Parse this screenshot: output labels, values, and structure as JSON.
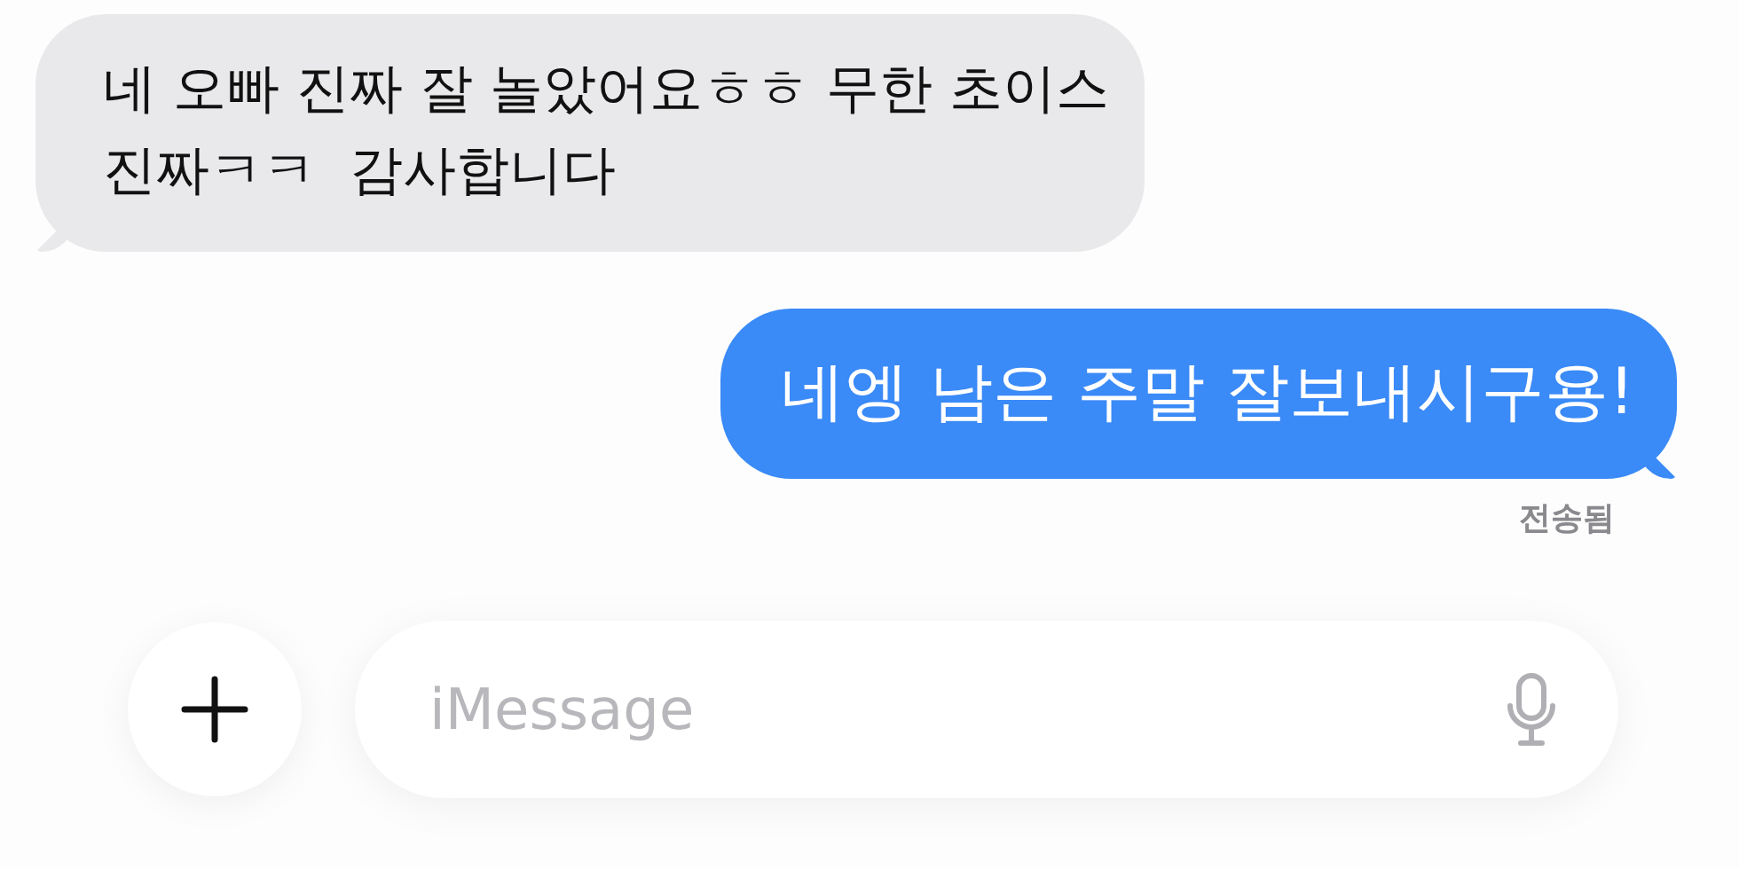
{
  "messages": [
    {
      "kind": "received",
      "text": "네 오빠 진짜 잘 놀았어요ㅎㅎ 무한 초이스\n진짜ㅋㅋ  감사합니다"
    },
    {
      "kind": "sent",
      "text": "네엥 남은 주말 잘보내시구용!"
    }
  ],
  "status": "전송됨",
  "composer": {
    "placeholder": "iMessage"
  }
}
